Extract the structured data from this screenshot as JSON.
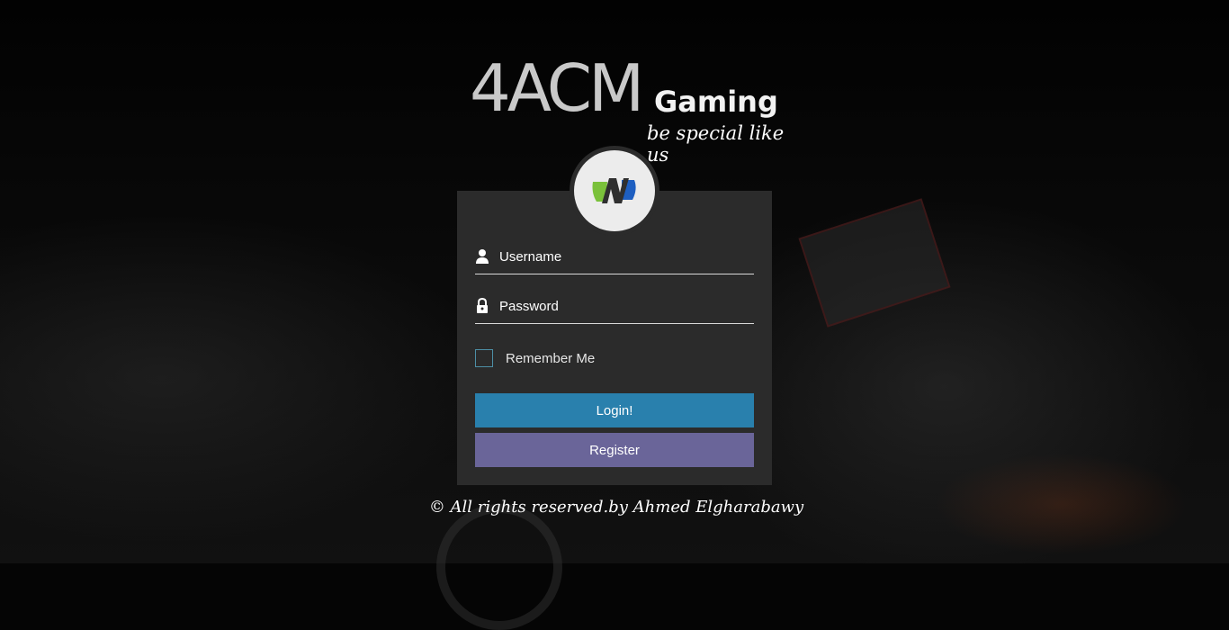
{
  "brand": {
    "name": "4ACM",
    "sub": "Gaming",
    "tagline": "be special like us"
  },
  "avatar": {
    "icon": "n-logo-icon",
    "colors": [
      "#7ac13a",
      "#2f2f2f",
      "#1e5fc1"
    ]
  },
  "form": {
    "username": {
      "placeholder": "Username",
      "value": "",
      "icon": "user-icon"
    },
    "password": {
      "placeholder": "Password",
      "value": "",
      "icon": "lock-icon"
    },
    "remember_label": "Remember Me",
    "remember_checked": false,
    "login_label": "Login!",
    "register_label": "Register"
  },
  "footer": {
    "text": "© All rights reserved.by Ahmed Elgharabawy"
  },
  "colors": {
    "panel": "#2b2b2b",
    "login": "#2980ad",
    "register": "#6a6599"
  }
}
